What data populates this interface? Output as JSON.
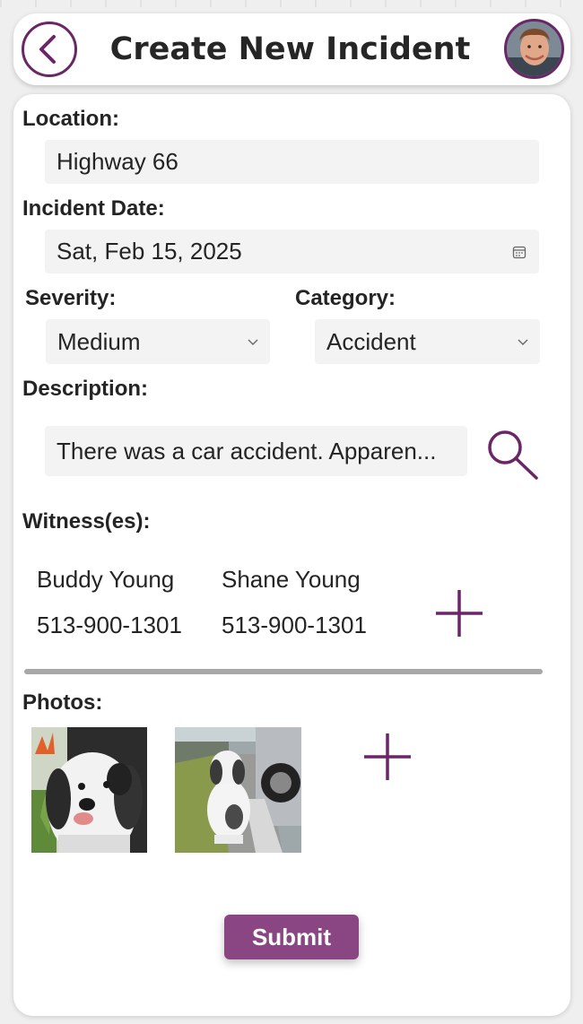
{
  "header": {
    "title": "Create New Incident",
    "back_icon": "chevron-left-icon",
    "avatar_description": "user avatar"
  },
  "form": {
    "location": {
      "label": "Location:",
      "value": "Highway 66"
    },
    "incident_date": {
      "label": "Incident Date:",
      "value": "Sat, Feb 15, 2025",
      "icon": "calendar-icon"
    },
    "severity": {
      "label": "Severity:",
      "value": "Medium"
    },
    "category": {
      "label": "Category:",
      "value": "Accident"
    },
    "description": {
      "label": "Description:",
      "value": "There was a car accident. Apparen...",
      "icon": "search-icon"
    },
    "witnesses": {
      "label": "Witness(es):",
      "items": [
        {
          "name": "Buddy Young",
          "phone": "513-900-1301"
        },
        {
          "name": "Shane Young",
          "phone": "513-900-1301"
        }
      ],
      "add_icon": "plus-icon"
    },
    "photos": {
      "label": "Photos:",
      "items": [
        {
          "subject": "dog selfie close-up"
        },
        {
          "subject": "dog sitting beside car"
        }
      ],
      "add_icon": "plus-icon"
    },
    "submit_label": "Submit"
  },
  "colors": {
    "accent": "#6b2667",
    "submit": "#8a4683",
    "field_bg": "#f3f3f3",
    "card_bg": "#ffffff",
    "page_bg": "#efefef"
  }
}
